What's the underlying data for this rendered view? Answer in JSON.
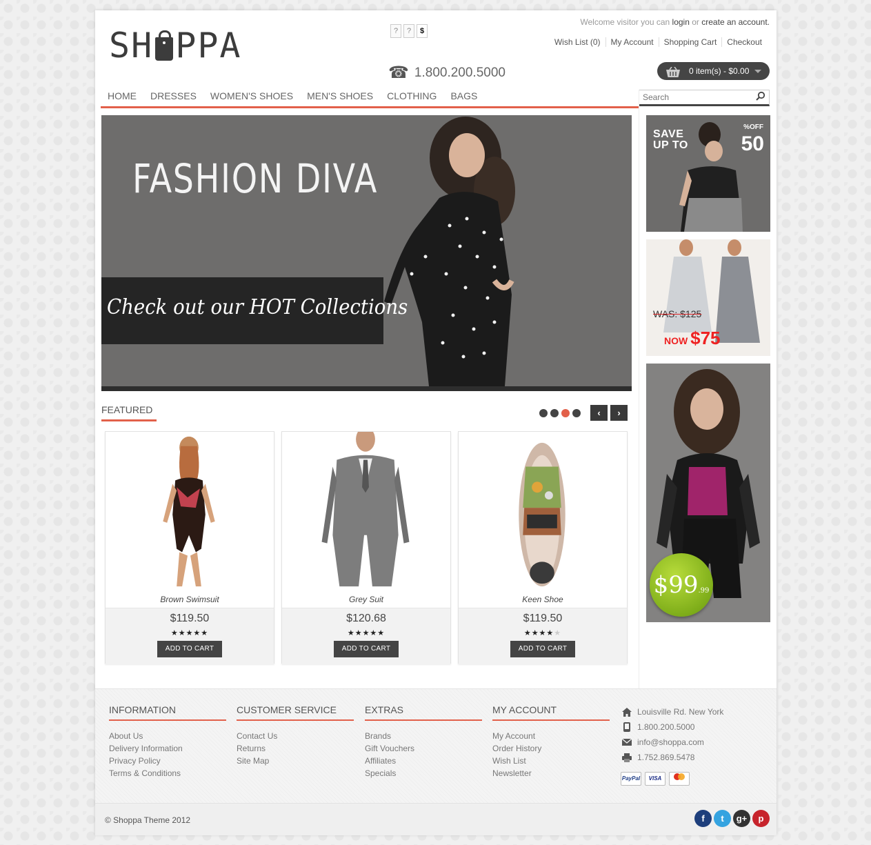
{
  "header": {
    "logo": "SHOPPA",
    "currencies": [
      "?",
      "?",
      "$"
    ],
    "phone": "1.800.200.5000",
    "welcome": {
      "prefix": "Welcome visitor you can",
      "login": "login",
      "or": "or",
      "create": "create an account."
    },
    "links": [
      "Wish List (0)",
      "My Account",
      "Shopping Cart",
      "Checkout"
    ],
    "cart": "0 item(s) - $0.00"
  },
  "nav": [
    "HOME",
    "DRESSES",
    "WOMEN'S SHOES",
    "MEN'S SHOES",
    "CLOTHING",
    "BAGS"
  ],
  "search": {
    "placeholder": "Search"
  },
  "hero": {
    "title": "FASHION DIVA",
    "tagline": "Check out our HOT Collections"
  },
  "featured": {
    "title": "FEATURED",
    "dots": 4,
    "active_dot": 3,
    "products": [
      {
        "name": "Brown Swimsuit",
        "price": "$119.50",
        "rating": 5,
        "button": "ADD TO CART"
      },
      {
        "name": "Grey Suit",
        "price": "$120.68",
        "rating": 5,
        "button": "ADD TO CART"
      },
      {
        "name": "Keen Shoe",
        "price": "$119.50",
        "rating": 4,
        "button": "ADD TO CART"
      }
    ]
  },
  "ads": {
    "ad1": {
      "save": "SAVE",
      "upto": "UP TO",
      "off": "%OFF",
      "value": "50"
    },
    "ad2": {
      "was": "WAS: $125",
      "now": "NOW",
      "now_price": "$75"
    },
    "ad3": {
      "price": "$99",
      "cents": ".99"
    }
  },
  "footer": {
    "columns": [
      {
        "title": "INFORMATION",
        "links": [
          "About Us",
          "Delivery Information",
          "Privacy Policy",
          "Terms & Conditions"
        ]
      },
      {
        "title": "CUSTOMER SERVICE",
        "links": [
          "Contact Us",
          "Returns",
          "Site Map"
        ]
      },
      {
        "title": "EXTRAS",
        "links": [
          "Brands",
          "Gift Vouchers",
          "Affiliates",
          "Specials"
        ]
      },
      {
        "title": "MY ACCOUNT",
        "links": [
          "My Account",
          "Order History",
          "Wish List",
          "Newsletter"
        ]
      }
    ],
    "contact": {
      "address": "Louisville Rd. New York",
      "phone": "1.800.200.5000",
      "email": "info@shoppa.com",
      "fax": "1.752.869.5478"
    },
    "payments": [
      "PayPal",
      "VISA",
      "MasterCard"
    ],
    "copyright": "© Shoppa Theme 2012",
    "social": [
      "facebook",
      "twitter",
      "google-plus",
      "pinterest"
    ]
  },
  "colors": {
    "accent": "#e2604a",
    "dark": "#444444",
    "badge": "#8dbd1e"
  }
}
